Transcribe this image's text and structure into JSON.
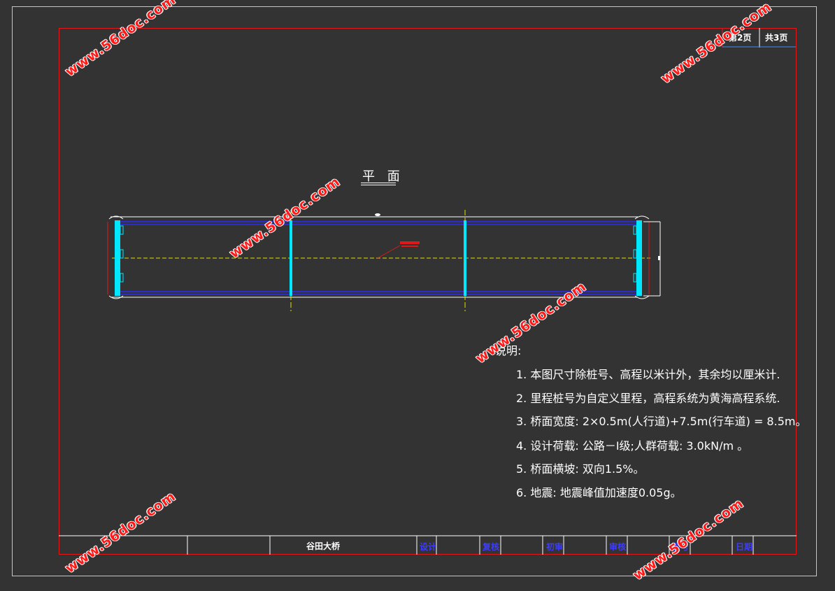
{
  "page_counter": {
    "current": "第2页",
    "total": "共3页"
  },
  "plan_title": "平 面",
  "notes": {
    "heading": "说明:",
    "items": [
      "1. 本图尺寸除桩号、高程以米计外，其余均以厘米计.",
      "2. 里程桩号为自定义里程，高程系统为黄海高程系统.",
      "3. 桥面宽度: 2×0.5m(人行道)+7.5m(行车道) = 8.5m。",
      "4. 设计荷载: 公路－Ⅰ级;人群荷载: 3.0kN/m 。",
      "5. 桥面横坡: 双向1.5%。",
      "6. 地震: 地震峰值加速度0.05g。"
    ]
  },
  "title_block": {
    "project_name": "谷田大桥",
    "design": "设计",
    "review": "复核",
    "preliminary_check": "初审",
    "approval": "审核",
    "figure_no": "图号",
    "date": "日期"
  },
  "watermark": "www.56doc.com",
  "colors": {
    "background": "#333333",
    "outer_frame": "#e0e000",
    "inner_frame": "#e01818",
    "deck_lines": "#2a2aff",
    "abutments_piers": "#00e8ff",
    "centerline": "#e0e000",
    "title_block_labels": "#3c3cff",
    "watermark": "#ff1a1a"
  }
}
